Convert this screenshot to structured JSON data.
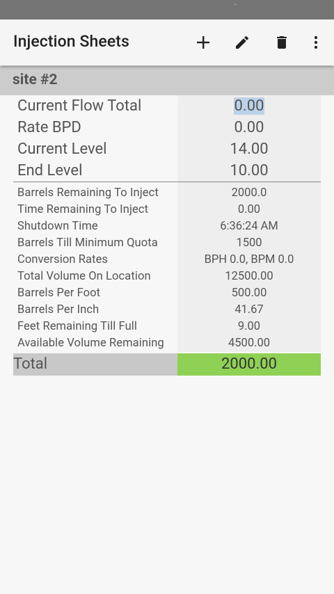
{
  "app_bar": {
    "title": "Injection Sheets",
    "actions": [
      {
        "name": "add",
        "icon": "plus-icon"
      },
      {
        "name": "edit",
        "icon": "pencil-icon"
      },
      {
        "name": "delete",
        "icon": "trash-icon"
      },
      {
        "name": "overflow",
        "icon": "more-vert-icon"
      }
    ]
  },
  "site": {
    "title": "site #2"
  },
  "primary_rows": [
    {
      "label": "Current Flow Total",
      "value": "0.00",
      "selected": true
    },
    {
      "label": "Rate BPD",
      "value": "0.00"
    },
    {
      "label": "Current Level",
      "value": "14.00"
    },
    {
      "label": "End Level",
      "value": "10.00"
    }
  ],
  "detail_rows": [
    {
      "label": "Barrels Remaining To Inject",
      "value": "2000.0"
    },
    {
      "label": "Time Remaining To Inject",
      "value": "0.00"
    },
    {
      "label": "Shutdown Time",
      "value": "6:36:24 AM"
    },
    {
      "label": "Barrels Till Minimum Quota",
      "value": "1500"
    },
    {
      "label": "Conversion Rates",
      "value": "BPH 0.0, BPM 0.0"
    },
    {
      "label": "Total Volume On Location",
      "value": "12500.00"
    },
    {
      "label": "Barrels Per Foot",
      "value": "500.00"
    },
    {
      "label": "Barrels Per Inch",
      "value": "41.67"
    },
    {
      "label": "Feet Remaining Till Full",
      "value": "9.00"
    },
    {
      "label": "Available Volume Remaining",
      "value": "4500.00"
    }
  ],
  "total": {
    "label": "Total",
    "value": "2000.00"
  },
  "colors": {
    "total_highlight": "#8fd155",
    "header_bg": "#cccccc",
    "value_column_bg": "#eeeeee",
    "selection": "#bcd2e8"
  }
}
